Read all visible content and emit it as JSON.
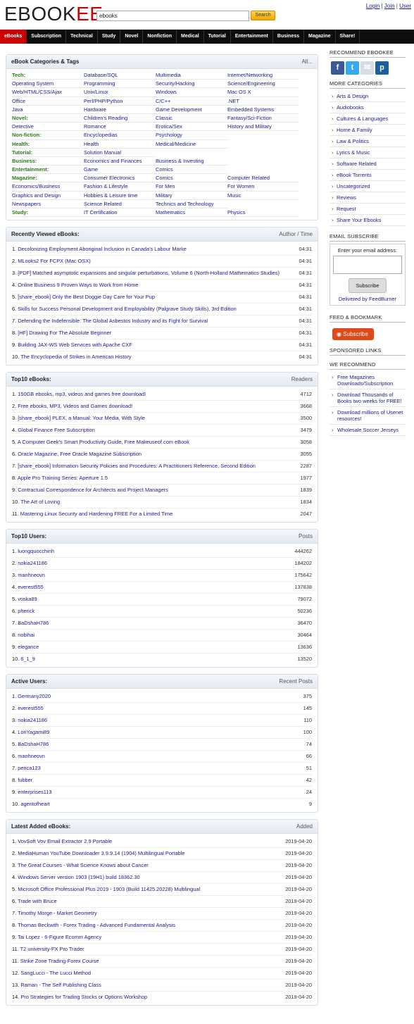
{
  "header": {
    "logo_main": "EBOOK",
    "logo_accent": "EE",
    "search_value": "ebooks",
    "search_button": "Search",
    "login": "Login",
    "join": "Join",
    "user": "User",
    "sep": "|"
  },
  "nav": [
    "eBooks",
    "Subscription",
    "Technical",
    "Study",
    "Novel",
    "Nonfiction",
    "Medical",
    "Tutorial",
    "Entertainment",
    "Business",
    "Magazine",
    "Share!"
  ],
  "categories": {
    "title": "eBook Categories & Tags",
    "all": "All...",
    "rows": [
      [
        "Tech:",
        "Database/SQL",
        "Multimedia",
        "Internet/Networking"
      ],
      [
        "Operating System",
        "Programming",
        "Security/Hacking",
        "Science/Engineering"
      ],
      [
        "Web/HTML/CSS/Ajax",
        "Unix/Linux",
        "Windows",
        "Mac OS X"
      ],
      [
        "Office",
        "Perl/PHP/Python",
        "C/C++",
        ".NET"
      ],
      [
        "Java",
        "Hardware",
        "Game Development",
        "Embedded Systems"
      ],
      [
        "Novel:",
        "Children's Reading",
        "Classic",
        "Fantasy/Sci-Fiction"
      ],
      [
        "Detective",
        "Romance",
        "Erotica/Sex",
        "History and Military"
      ],
      [
        "Non-fiction:",
        "Encyclopedias",
        "Psychology",
        ""
      ],
      [
        "Health:",
        "Health",
        "Medical/Medicine",
        ""
      ],
      [
        "Tutorial:",
        "Solution Manual",
        "",
        ""
      ],
      [
        "Business:",
        "Economics and Finances",
        "Business & Investing",
        ""
      ],
      [
        "Entertainment:",
        "Game",
        "Comics",
        ""
      ],
      [
        "Magazine:",
        "Consumer Electronics",
        "Comics",
        "Computer Related"
      ],
      [
        "Economics/Business",
        "Fashion & Lifestyle",
        "For Men",
        "For Women"
      ],
      [
        "Graphics and Design",
        "Hobbies & Leisure time",
        "Military",
        "Music"
      ],
      [
        "Newspapers",
        "Science Related",
        "Technics and Technology",
        ""
      ],
      [
        "Study:",
        "IT Certification",
        "Mathematics",
        "Physics"
      ]
    ],
    "label_rows": [
      0,
      5,
      7,
      8,
      9,
      10,
      11,
      12,
      16
    ]
  },
  "recent": {
    "title": "Recently Viewed eBooks:",
    "right": "Author / Time",
    "items": [
      {
        "n": "1.",
        "t": "Decolonizing Employment Aboriginal Inclusion in Canada's Labour Marke",
        "v": "04:31"
      },
      {
        "n": "2.",
        "t": "MLooks2 For FCPX (Mac OSX)",
        "v": "04:31"
      },
      {
        "n": "3.",
        "t": "[PDF] Matched asymptotic expansions and singular perturbations, Volume 6 (North-Holland Mathematics Studies)",
        "v": "04:31"
      },
      {
        "n": "4.",
        "t": "Online Business 9 Proven Ways to Work from Home",
        "v": "04:31"
      },
      {
        "n": "5.",
        "t": "[share_ebook] Only the Best Doggie Day Care for Your Pup",
        "v": "04:31"
      },
      {
        "n": "6.",
        "t": "Skills for Success Personal Development and Employability (Palgrave Study Skills), 3rd Edition",
        "v": "04:31"
      },
      {
        "n": "7.",
        "t": "Defending the Indefensible: The Global Asbestos Industry and its Fight for Survival",
        "v": "04:31"
      },
      {
        "n": "8.",
        "t": "[HF] Drawing For The Absolute Beginner",
        "v": "04:31"
      },
      {
        "n": "9.",
        "t": "Building JAX-WS Web Services with Apache CXF",
        "v": "04:31"
      },
      {
        "n": "10.",
        "t": "The Encyclopedia of Strikes in American History",
        "v": "04:31"
      }
    ]
  },
  "top10": {
    "title": "Top10 eBooks:",
    "right": "Readers",
    "items": [
      {
        "n": "1.",
        "t": "150GB ebooks, mp3, videos and games free download!",
        "v": "4712"
      },
      {
        "n": "2.",
        "t": "Free ebooks, MP3, Videos and Games download!",
        "v": "3668"
      },
      {
        "n": "3.",
        "t": "[share_ebook] PLEX, a Manual: Your Media, With Style",
        "v": "3500"
      },
      {
        "n": "4.",
        "t": "Global Finance Free Subscription",
        "v": "3479"
      },
      {
        "n": "5.",
        "t": "A Computer Geek's Smart Productivity Guide, Free Makeuseof.com eBook",
        "v": "3058"
      },
      {
        "n": "6.",
        "t": "Oracle Magazine, Free Oracle Magazine Subscription",
        "v": "3055"
      },
      {
        "n": "7.",
        "t": "[share_ebook] Information Security Policies and Procedures: A Practitioners Reference, Second Edition",
        "v": "2287"
      },
      {
        "n": "8.",
        "t": "Apple Pro Training Series: Aperture 1.5",
        "v": "1977"
      },
      {
        "n": "9.",
        "t": "Contractual Correspondence for Architects and Project Managers",
        "v": "1839"
      },
      {
        "n": "10.",
        "t": "The Art of Loving",
        "v": "1834"
      },
      {
        "n": "11.",
        "t": "Mastering Linux Security and Hardening FREE For a Limited Time",
        "v": "2047"
      }
    ]
  },
  "topusers": {
    "title": "Top10 Users:",
    "right": "Posts",
    "items": [
      {
        "n": "1.",
        "t": "luongquocchinh",
        "v": "444262"
      },
      {
        "n": "2.",
        "t": "nokia241186",
        "v": "184202"
      },
      {
        "n": "3.",
        "t": "manhneovn",
        "v": "175642"
      },
      {
        "n": "4.",
        "t": "everest555",
        "v": "137838"
      },
      {
        "n": "5.",
        "t": "voska89",
        "v": "79072"
      },
      {
        "n": "6.",
        "t": "pherick",
        "v": "50236"
      },
      {
        "n": "7.",
        "t": "BaDshaH786",
        "v": "36470"
      },
      {
        "n": "8.",
        "t": "nobihai",
        "v": "30464"
      },
      {
        "n": "9.",
        "t": "elegance",
        "v": "13636"
      },
      {
        "n": "10.",
        "t": "6_1_9",
        "v": "13520"
      }
    ]
  },
  "active": {
    "title": "Active Users:",
    "right": "Recent Posts",
    "items": [
      {
        "n": "1.",
        "t": "Germany2020",
        "v": "375"
      },
      {
        "n": "2.",
        "t": "everest555",
        "v": "145"
      },
      {
        "n": "3.",
        "t": "nokia241186",
        "v": "110"
      },
      {
        "n": "4.",
        "t": "LoriYagami89",
        "v": "100"
      },
      {
        "n": "5.",
        "t": "BaDshaH786",
        "v": "74"
      },
      {
        "n": "6.",
        "t": "manhneovn",
        "v": "66"
      },
      {
        "n": "7.",
        "t": "perica123",
        "v": "51"
      },
      {
        "n": "8.",
        "t": "fubber",
        "v": "42"
      },
      {
        "n": "9.",
        "t": "enterprises113",
        "v": "24"
      },
      {
        "n": "10.",
        "t": "agentofheart",
        "v": "9"
      }
    ]
  },
  "latest": {
    "title": "Latest Added eBooks:",
    "right": "Added",
    "items": [
      {
        "n": "1.",
        "t": "VovSoft Vov Email Extractor 2.9 Portable",
        "v": "2019-04-20"
      },
      {
        "n": "2.",
        "t": "MediaHuman YouTube Downloader 3.9.9.14 (1904) Multilingual Portable",
        "v": "2019-04-20"
      },
      {
        "n": "3.",
        "t": "The Great Courses - What Science Knows about Cancer",
        "v": "2019-04-20"
      },
      {
        "n": "4.",
        "t": "Windows Server version 1903 (19H1) build 18362.30",
        "v": "2019-04-20"
      },
      {
        "n": "5.",
        "t": "Microsoft Office Professional Plus 2019 - 1903 (Build 11425.20228) Multilingual",
        "v": "2019-04-20"
      },
      {
        "n": "6.",
        "t": "Trade with Bruce",
        "v": "2019-04-20"
      },
      {
        "n": "7.",
        "t": "Timothy Morge - Market Geometry",
        "v": "2019-04-20"
      },
      {
        "n": "8.",
        "t": "Thomas Beckwith - Forex Trading - Advanced Fundamental Analysis",
        "v": "2019-04-20"
      },
      {
        "n": "9.",
        "t": "Tai Lopez - 6-Figure Ecomm Agency",
        "v": "2019-04-20"
      },
      {
        "n": "11.",
        "t": "T2 university-FX Pro Trader",
        "v": "2019-04-20"
      },
      {
        "n": "11.",
        "t": "Strike Zone Trading-Forex Course",
        "v": "2019-04-20"
      },
      {
        "n": "12.",
        "t": "SangLucci - The Lucci Method",
        "v": "2019-04-20"
      },
      {
        "n": "13.",
        "t": "Raman - The Self Publishing Class",
        "v": "2019-04-20"
      },
      {
        "n": "14.",
        "t": "Pro Strategies for Trading Stocks or Options Workshop",
        "v": "2019-04-20"
      }
    ]
  },
  "sidebar": {
    "recommend_title": "RECOMMEND EBOOKEE",
    "social": [
      {
        "icon": "facebook-icon",
        "glyph": "f"
      },
      {
        "icon": "twitter-icon",
        "glyph": "t"
      },
      {
        "icon": "mail-icon",
        "glyph": "✉"
      },
      {
        "icon": "pinboard-icon",
        "glyph": "p"
      }
    ],
    "more_title": "MORE CATEGORIES",
    "more": [
      "Arts & Design",
      "Audiobooks",
      "Cultures & Languages",
      "Home & Family",
      "Law & Politics",
      "Lyrics & Music",
      "Software Related",
      "eBook Torrents",
      "Uncategorized",
      "Reviews",
      "Request",
      "Share Your Ebooks"
    ],
    "email_title": "EMAIL SUBSCRIBE",
    "email_label": "Enter your email address:",
    "subscribe": "Subscribe",
    "feedburner": "Delivered by FeedBurner",
    "feed_title": "FEED & BOOKMARK",
    "rss": "Subscribe",
    "sponsored_title": "SPONSORED LINKS",
    "we_title": "WE RECOMMEND",
    "we": [
      "Free Magazines Downloads/Subscription",
      "Download Thousands of Books two weeks for FREE!",
      "Download millions of Usenet resources!",
      "Wholesale Soccer Jerseys"
    ]
  }
}
